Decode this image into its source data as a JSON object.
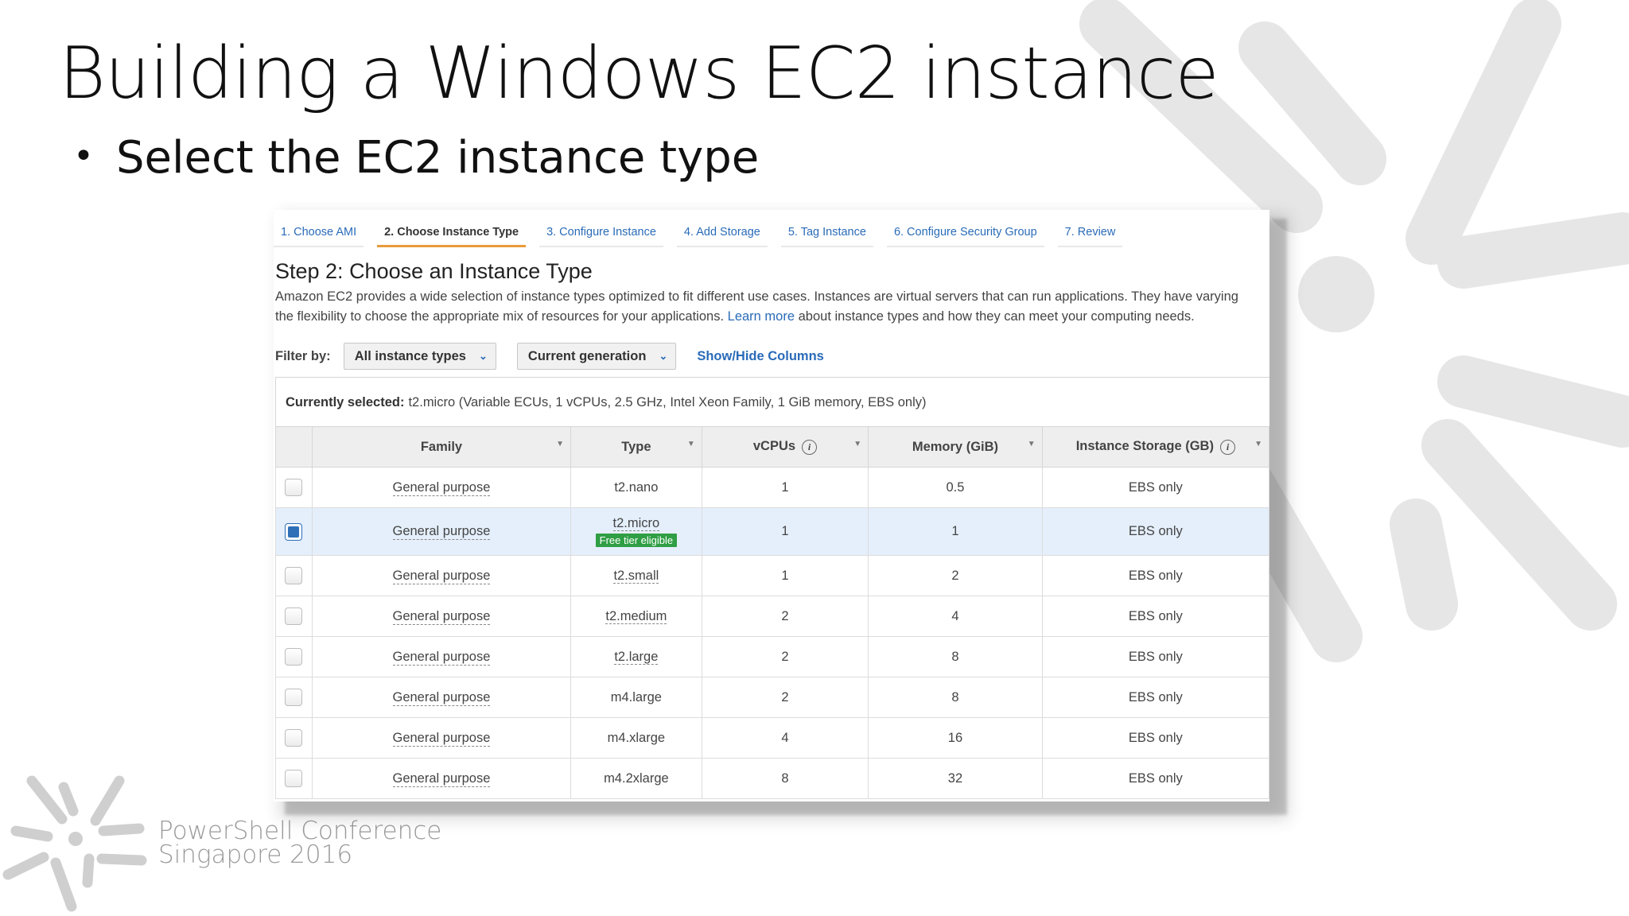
{
  "slide": {
    "title": "Building a Windows EC2 instance",
    "bullet": "Select the EC2 instance type",
    "conference_line1": "PowerShell Conference",
    "conference_line2": "Singapore 2016"
  },
  "wizard": {
    "tabs": [
      {
        "label": "1. Choose AMI",
        "active": false
      },
      {
        "label": "2. Choose Instance Type",
        "active": true
      },
      {
        "label": "3. Configure Instance",
        "active": false
      },
      {
        "label": "4. Add Storage",
        "active": false
      },
      {
        "label": "5. Tag Instance",
        "active": false
      },
      {
        "label": "6. Configure Security Group",
        "active": false
      },
      {
        "label": "7. Review",
        "active": false
      }
    ]
  },
  "step": {
    "heading": "Step 2: Choose an Instance Type",
    "desc_part1": "Amazon EC2 provides a wide selection of instance types optimized to fit different use cases. Instances are virtual servers that can run applications. They have varying",
    "desc_part2": "the flexibility to choose the appropriate mix of resources for your applications.",
    "learn_more": "Learn more",
    "desc_part3": "about instance types and how they can meet your computing needs."
  },
  "filter": {
    "label": "Filter by:",
    "type_select": "All instance types",
    "generation_select": "Current generation",
    "show_hide": "Show/Hide Columns"
  },
  "selected": {
    "label": "Currently selected:",
    "value": "t2.micro (Variable ECUs, 1 vCPUs, 2.5 GHz, Intel Xeon Family, 1 GiB memory, EBS only)"
  },
  "table": {
    "headers": {
      "family": "Family",
      "type": "Type",
      "vcpus": "vCPUs",
      "memory": "Memory (GiB)",
      "storage": "Instance Storage (GB)"
    },
    "free_tier_label": "Free tier eligible",
    "rows": [
      {
        "family": "General purpose",
        "type": "t2.nano",
        "vcpus": "1",
        "memory": "0.5",
        "storage": "EBS only"
      },
      {
        "family": "General purpose",
        "type": "t2.micro",
        "vcpus": "1",
        "memory": "1",
        "storage": "EBS only"
      },
      {
        "family": "General purpose",
        "type": "t2.small",
        "vcpus": "1",
        "memory": "2",
        "storage": "EBS only"
      },
      {
        "family": "General purpose",
        "type": "t2.medium",
        "vcpus": "2",
        "memory": "4",
        "storage": "EBS only"
      },
      {
        "family": "General purpose",
        "type": "t2.large",
        "vcpus": "2",
        "memory": "8",
        "storage": "EBS only"
      },
      {
        "family": "General purpose",
        "type": "m4.large",
        "vcpus": "2",
        "memory": "8",
        "storage": "EBS only"
      },
      {
        "family": "General purpose",
        "type": "m4.xlarge",
        "vcpus": "4",
        "memory": "16",
        "storage": "EBS only"
      },
      {
        "family": "General purpose",
        "type": "m4.2xlarge",
        "vcpus": "8",
        "memory": "32",
        "storage": "EBS only"
      }
    ]
  },
  "icons": {
    "sort": "sort-caret-icon",
    "info": "info-circle-icon",
    "dropdown": "chevron-down-icon"
  }
}
